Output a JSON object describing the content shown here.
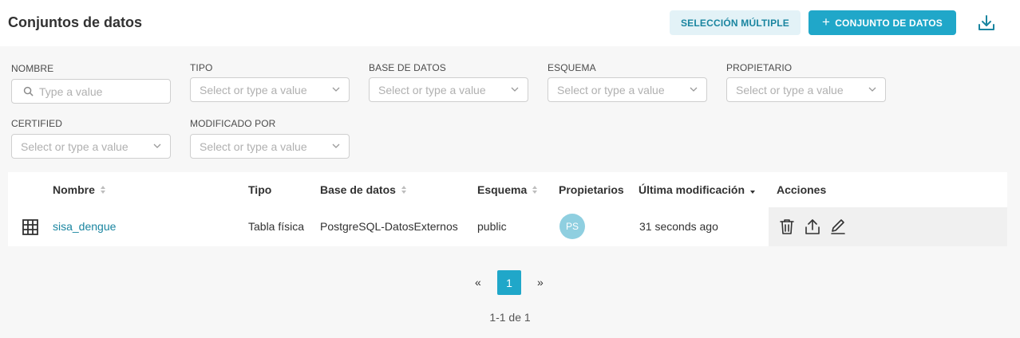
{
  "header": {
    "title": "Conjuntos de datos",
    "multi_select_label": "SELECCIÓN MÚLTIPLE",
    "add_plus": "+",
    "add_label": "CONJUNTO DE DATOS"
  },
  "filters": {
    "nombre": {
      "label": "NOMBRE",
      "placeholder": "Type a value"
    },
    "tipo": {
      "label": "TIPO",
      "placeholder": "Select or type a value"
    },
    "base": {
      "label": "BASE DE DATOS",
      "placeholder": "Select or type a value"
    },
    "esquema": {
      "label": "ESQUEMA",
      "placeholder": "Select or type a value"
    },
    "propietario": {
      "label": "PROPIETARIO",
      "placeholder": "Select or type a value"
    },
    "certified": {
      "label": "CERTIFIED",
      "placeholder": "Select or type a value"
    },
    "modificado": {
      "label": "MODIFICADO POR",
      "placeholder": "Select or type a value"
    }
  },
  "table": {
    "columns": [
      "Nombre",
      "Tipo",
      "Base de datos",
      "Esquema",
      "Propietarios",
      "Última modificación",
      "Acciones"
    ],
    "rows": [
      {
        "nombre": "sisa_dengue",
        "tipo": "Tabla física",
        "base": "PostgreSQL-DatosExternos",
        "esquema": "public",
        "owner_initials": "PS",
        "modificado": "31 seconds ago"
      }
    ]
  },
  "pagination": {
    "prev": "«",
    "current": "1",
    "next": "»",
    "range": "1-1 de 1"
  },
  "colors": {
    "primary": "#20a7c9",
    "primary_light": "#e3f2f7",
    "link": "#1a85a0"
  }
}
